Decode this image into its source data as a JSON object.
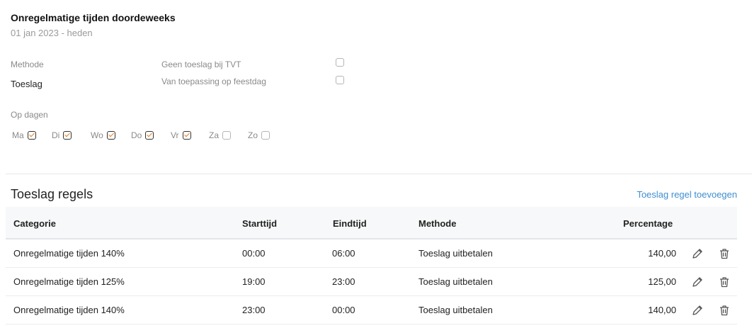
{
  "header": {
    "title": "Onregelmatige tijden doordeweeks",
    "period": "01 jan 2023 - heden"
  },
  "settings": {
    "method_label": "Methode",
    "method_value": "Toeslag",
    "no_toeslag_tvt_label": "Geen toeslag bij TVT",
    "no_toeslag_tvt_checked": false,
    "holiday_label": "Van toepassing op feestdag",
    "holiday_checked": false
  },
  "days": {
    "label": "Op dagen",
    "items": [
      {
        "label": "Ma",
        "checked": true
      },
      {
        "label": "Di",
        "checked": true
      },
      {
        "label": "Wo",
        "checked": true
      },
      {
        "label": "Do",
        "checked": true
      },
      {
        "label": "Vr",
        "checked": true
      },
      {
        "label": "Za",
        "checked": false
      },
      {
        "label": "Zo",
        "checked": false
      }
    ]
  },
  "rules": {
    "title": "Toeslag regels",
    "add_label": "Toeslag regel toevoegen",
    "columns": {
      "category": "Categorie",
      "start": "Starttijd",
      "end": "Eindtijd",
      "method": "Methode",
      "percentage": "Percentage"
    },
    "rows": [
      {
        "category": "Onregelmatige tijden 140%",
        "start": "00:00",
        "end": "06:00",
        "method": "Toeslag uitbetalen",
        "percentage": "140,00"
      },
      {
        "category": "Onregelmatige tijden 125%",
        "start": "19:00",
        "end": "23:00",
        "method": "Toeslag uitbetalen",
        "percentage": "125,00"
      },
      {
        "category": "Onregelmatige tijden 140%",
        "start": "23:00",
        "end": "00:00",
        "method": "Toeslag uitbetalen",
        "percentage": "140,00"
      }
    ]
  },
  "icons": {
    "edit": "pencil-icon",
    "delete": "trash-icon"
  },
  "colors": {
    "link": "#3e8fd1",
    "checkmark": "#e87b1b"
  }
}
